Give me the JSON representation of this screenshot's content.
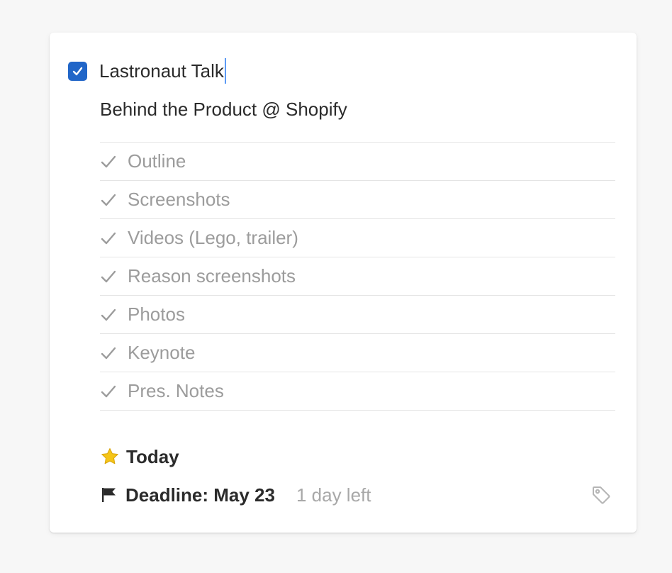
{
  "todo": {
    "completed": true,
    "title": "Lastronaut Talk",
    "notes": "Behind the Product @ Shopify"
  },
  "checklist": [
    {
      "label": "Outline",
      "done": true
    },
    {
      "label": "Screenshots",
      "done": true
    },
    {
      "label": "Videos (Lego, trailer)",
      "done": true
    },
    {
      "label": "Reason screenshots",
      "done": true
    },
    {
      "label": "Photos",
      "done": true
    },
    {
      "label": "Keynote",
      "done": true
    },
    {
      "label": "Pres. Notes",
      "done": true
    }
  ],
  "when": {
    "icon": "star-icon",
    "label": "Today"
  },
  "deadline": {
    "icon": "flag-icon",
    "label": "Deadline: May 23",
    "remaining": "1 day left"
  },
  "tags": {
    "icon": "tag-icon"
  },
  "colors": {
    "accent": "#2166c8",
    "caret": "#5b9af5",
    "muted_text": "#9c9c9c",
    "star": "#f5c518"
  }
}
